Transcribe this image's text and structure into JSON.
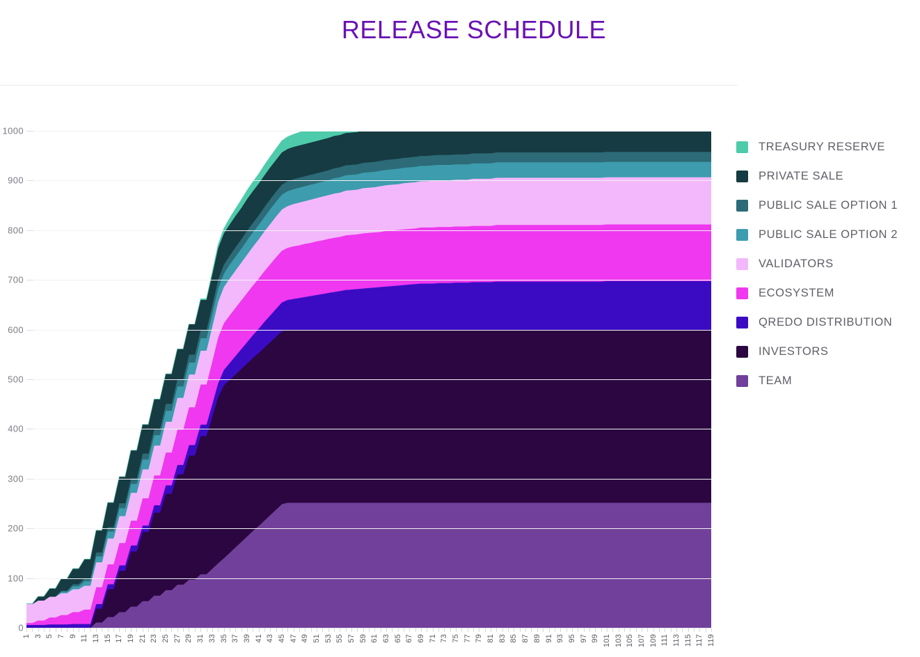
{
  "title": "RELEASE SCHEDULE",
  "title_color": "#6a11b5",
  "legend": {
    "position": "right",
    "items": [
      {
        "label": "TREASURY RESERVE",
        "color": "#4ecbab"
      },
      {
        "label": "PRIVATE SALE",
        "color": "#173b42"
      },
      {
        "label": "PUBLIC SALE OPTION 1",
        "color": "#2c6b77"
      },
      {
        "label": "PUBLIC SALE OPTION 2",
        "color": "#3d9cad"
      },
      {
        "label": "VALIDATORS",
        "color": "#f3b8fb"
      },
      {
        "label": "ECOSYSTEM",
        "color": "#ef38ef"
      },
      {
        "label": "QREDO DISTRIBUTION",
        "color": "#3b0bc4"
      },
      {
        "label": "INVESTORS",
        "color": "#2b0640"
      },
      {
        "label": "TEAM",
        "color": "#71409a"
      }
    ]
  },
  "chart_data": {
    "type": "area",
    "stacked": true,
    "title": "RELEASE SCHEDULE",
    "xlabel": "",
    "ylabel": "",
    "ylim": [
      0,
      1000
    ],
    "xlim": [
      1,
      119
    ],
    "grid": true,
    "legend_position": "right",
    "y_ticks": [
      0,
      100,
      200,
      300,
      400,
      500,
      600,
      700,
      800,
      900,
      1000
    ],
    "x_ticks": [
      1,
      3,
      5,
      7,
      9,
      11,
      13,
      15,
      17,
      19,
      21,
      23,
      25,
      27,
      29,
      31,
      33,
      35,
      37,
      39,
      41,
      43,
      45,
      47,
      49,
      51,
      53,
      55,
      57,
      59,
      61,
      63,
      65,
      67,
      69,
      71,
      73,
      75,
      77,
      79,
      81,
      83,
      85,
      87,
      89,
      91,
      93,
      95,
      97,
      99,
      101,
      103,
      105,
      107,
      109,
      111,
      113,
      115,
      117,
      119
    ],
    "x": [
      1,
      2,
      3,
      4,
      5,
      6,
      7,
      8,
      9,
      10,
      11,
      12,
      13,
      14,
      15,
      16,
      17,
      18,
      19,
      20,
      21,
      22,
      23,
      24,
      25,
      26,
      27,
      28,
      29,
      30,
      31,
      32,
      33,
      34,
      35,
      36,
      37,
      38,
      39,
      40,
      41,
      42,
      43,
      44,
      45,
      46,
      47,
      48,
      49,
      50,
      51,
      52,
      53,
      54,
      55,
      56,
      57,
      58,
      59,
      60,
      61,
      62,
      63,
      64,
      65,
      66,
      67,
      68,
      69,
      70,
      71,
      72,
      73,
      74,
      75,
      76,
      77,
      78,
      79,
      80,
      81,
      82,
      83,
      84,
      85,
      86,
      87,
      88,
      89,
      90,
      91,
      92,
      93,
      94,
      95,
      96,
      97,
      98,
      99,
      100,
      101,
      102,
      103,
      104,
      105,
      106,
      107,
      108,
      109,
      110,
      111,
      112,
      113,
      114,
      115,
      116,
      117,
      118,
      119
    ],
    "series": [
      {
        "name": "TEAM",
        "color": "#71409a",
        "values": [
          0,
          0,
          0,
          0,
          0,
          0,
          0,
          0,
          0,
          0,
          0,
          0,
          11,
          11,
          22,
          22,
          32,
          32,
          43,
          43,
          54,
          54,
          65,
          65,
          76,
          76,
          87,
          87,
          97,
          97,
          108,
          108,
          119,
          130,
          140,
          151,
          162,
          173,
          184,
          195,
          205,
          216,
          227,
          238,
          249,
          252,
          252,
          252,
          252,
          252,
          252,
          252,
          252,
          252,
          252,
          252,
          252,
          252,
          252,
          252,
          252,
          252,
          252,
          252,
          252,
          252,
          252,
          252,
          252,
          252,
          252,
          252,
          252,
          252,
          252,
          252,
          252,
          252,
          252,
          252,
          252,
          252,
          252,
          252,
          252,
          252,
          252,
          252,
          252,
          252,
          252,
          252,
          252,
          252,
          252,
          252,
          252,
          252,
          252,
          252,
          252,
          252,
          252,
          252,
          252,
          252,
          252,
          252,
          252,
          252,
          252,
          252,
          252,
          252,
          252,
          252,
          252,
          252,
          252
        ]
      },
      {
        "name": "INVESTORS",
        "color": "#2b0640",
        "values": [
          0,
          0,
          0,
          0,
          0,
          0,
          0,
          0,
          0,
          0,
          0,
          0,
          28,
          28,
          56,
          56,
          83,
          83,
          111,
          111,
          139,
          139,
          167,
          167,
          194,
          194,
          222,
          222,
          250,
          250,
          278,
          278,
          306,
          334,
          348,
          348,
          348,
          348,
          348,
          348,
          348,
          348,
          348,
          348,
          348,
          348,
          348,
          348,
          348,
          348,
          348,
          348,
          348,
          348,
          348,
          348,
          348,
          348,
          348,
          348,
          348,
          348,
          348,
          348,
          348,
          348,
          348,
          348,
          348,
          348,
          348,
          348,
          348,
          348,
          348,
          348,
          348,
          348,
          348,
          348,
          348,
          348,
          348,
          348,
          348,
          348,
          348,
          348,
          348,
          348,
          348,
          348,
          348,
          348,
          348,
          348,
          348,
          348,
          348,
          348,
          348,
          348,
          348,
          348,
          348,
          348,
          348,
          348,
          348,
          348,
          348,
          348,
          348,
          348,
          348,
          348,
          348,
          348,
          348
        ]
      },
      {
        "name": "QREDO DISTRIBUTION",
        "color": "#3b0bc4",
        "values": [
          6,
          6,
          6,
          6,
          7,
          7,
          7,
          7,
          8,
          8,
          8,
          8,
          9,
          9,
          10,
          10,
          11,
          11,
          12,
          12,
          13,
          13,
          15,
          15,
          17,
          17,
          19,
          19,
          21,
          21,
          23,
          23,
          25,
          28,
          31,
          34,
          37,
          40,
          43,
          46,
          49,
          52,
          54,
          56,
          58,
          60,
          62,
          64,
          66,
          68,
          70,
          72,
          74,
          76,
          78,
          80,
          81,
          82,
          83,
          84,
          85,
          86,
          87,
          88,
          89,
          90,
          91,
          92,
          93,
          93,
          93,
          94,
          94,
          94,
          95,
          95,
          95,
          96,
          96,
          96,
          96,
          97,
          97,
          97,
          97,
          97,
          97,
          97,
          97,
          97,
          97,
          97,
          97,
          97,
          97,
          97,
          97,
          97,
          97,
          97,
          98,
          98,
          98,
          98,
          98,
          98,
          98,
          98,
          98,
          98,
          98,
          98,
          98,
          98,
          98,
          98,
          98,
          98,
          98
        ]
      },
      {
        "name": "ECOSYSTEM",
        "color": "#ef38ef",
        "values": [
          4,
          4,
          9,
          9,
          14,
          14,
          19,
          19,
          24,
          24,
          29,
          29,
          34,
          34,
          40,
          40,
          45,
          45,
          50,
          50,
          55,
          55,
          60,
          60,
          66,
          66,
          71,
          71,
          76,
          76,
          81,
          81,
          86,
          92,
          94,
          96,
          97,
          98,
          99,
          100,
          101,
          102,
          103,
          104,
          104,
          105,
          106,
          106,
          107,
          107,
          108,
          108,
          109,
          109,
          109,
          110,
          110,
          110,
          111,
          111,
          111,
          111,
          112,
          112,
          112,
          112,
          112,
          112,
          113,
          113,
          113,
          113,
          113,
          113,
          113,
          113,
          113,
          113,
          113,
          113,
          113,
          114,
          114,
          114,
          114,
          114,
          114,
          114,
          114,
          114,
          114,
          114,
          114,
          114,
          114,
          114,
          114,
          114,
          114,
          114,
          114,
          114,
          114,
          114,
          114,
          114,
          114,
          114,
          114,
          114,
          114,
          114,
          114,
          114,
          114,
          114,
          114,
          114,
          114
        ]
      },
      {
        "name": "VALIDATORS",
        "color": "#f3b8fb",
        "values": [
          38,
          38,
          40,
          40,
          42,
          42,
          44,
          44,
          46,
          46,
          48,
          48,
          50,
          50,
          52,
          52,
          54,
          54,
          56,
          56,
          58,
          58,
          60,
          60,
          62,
          62,
          64,
          64,
          66,
          66,
          68,
          68,
          70,
          72,
          73,
          74,
          75,
          76,
          77,
          78,
          79,
          80,
          81,
          82,
          83,
          84,
          85,
          86,
          86,
          87,
          87,
          88,
          88,
          89,
          89,
          90,
          90,
          90,
          91,
          91,
          91,
          92,
          92,
          92,
          92,
          93,
          93,
          93,
          93,
          93,
          94,
          94,
          94,
          94,
          94,
          94,
          94,
          95,
          95,
          95,
          95,
          95,
          95,
          95,
          95,
          95,
          95,
          95,
          95,
          95,
          95,
          95,
          95,
          95,
          95,
          95,
          95,
          95,
          95,
          95,
          95,
          95,
          95,
          95,
          95,
          95,
          95,
          95,
          95,
          95,
          95,
          95,
          95,
          95,
          95,
          95,
          95,
          95,
          95
        ]
      },
      {
        "name": "PUBLIC SALE OPTION 2",
        "color": "#3d9cad",
        "values": [
          0,
          0,
          0,
          0,
          0,
          0,
          3,
          3,
          6,
          6,
          9,
          9,
          12,
          12,
          14,
          14,
          16,
          16,
          18,
          18,
          20,
          20,
          21,
          21,
          22,
          22,
          23,
          23,
          24,
          24,
          25,
          25,
          26,
          27,
          27,
          28,
          28,
          28,
          29,
          29,
          29,
          29,
          30,
          30,
          30,
          30,
          30,
          30,
          30,
          30,
          30,
          30,
          30,
          31,
          31,
          31,
          31,
          31,
          31,
          31,
          31,
          31,
          31,
          31,
          31,
          31,
          31,
          31,
          31,
          31,
          31,
          31,
          31,
          31,
          31,
          31,
          31,
          31,
          31,
          31,
          31,
          31,
          31,
          31,
          31,
          31,
          31,
          31,
          31,
          31,
          31,
          31,
          31,
          31,
          31,
          31,
          31,
          31,
          31,
          31,
          31,
          31,
          31,
          31,
          31,
          31,
          31,
          31,
          31,
          31,
          31,
          31,
          31,
          31,
          31,
          31,
          31,
          31,
          31
        ]
      },
      {
        "name": "PUBLIC SALE OPTION 1",
        "color": "#2c6b77",
        "values": [
          0,
          0,
          0,
          0,
          0,
          0,
          2,
          2,
          4,
          4,
          6,
          6,
          8,
          8,
          9,
          9,
          10,
          10,
          11,
          11,
          12,
          12,
          13,
          13,
          14,
          14,
          15,
          15,
          16,
          16,
          16,
          16,
          17,
          18,
          18,
          18,
          19,
          19,
          19,
          19,
          19,
          20,
          20,
          20,
          20,
          20,
          20,
          20,
          20,
          20,
          20,
          20,
          20,
          20,
          20,
          20,
          20,
          20,
          20,
          20,
          20,
          20,
          20,
          20,
          20,
          20,
          20,
          20,
          20,
          20,
          20,
          20,
          20,
          20,
          20,
          20,
          20,
          20,
          20,
          20,
          20,
          20,
          20,
          20,
          20,
          20,
          20,
          20,
          20,
          20,
          20,
          20,
          20,
          20,
          20,
          20,
          20,
          20,
          20,
          20,
          20,
          20,
          20,
          20,
          20,
          20,
          20,
          20,
          20,
          20,
          20,
          20,
          20,
          20,
          20,
          20,
          20,
          20,
          20
        ]
      },
      {
        "name": "PRIVATE SALE",
        "color": "#173b42",
        "values": [
          0,
          0,
          8,
          8,
          16,
          16,
          24,
          24,
          31,
          31,
          38,
          38,
          44,
          44,
          49,
          49,
          53,
          53,
          56,
          56,
          58,
          58,
          59,
          59,
          60,
          60,
          60,
          60,
          61,
          61,
          61,
          61,
          62,
          63,
          63,
          63,
          63,
          63,
          64,
          64,
          64,
          64,
          64,
          64,
          65,
          65,
          65,
          65,
          65,
          65,
          65,
          65,
          65,
          65,
          65,
          65,
          65,
          65,
          65,
          65,
          65,
          65,
          65,
          65,
          65,
          65,
          65,
          65,
          65,
          65,
          65,
          65,
          65,
          65,
          65,
          65,
          65,
          65,
          65,
          65,
          65,
          65,
          65,
          65,
          65,
          65,
          65,
          65,
          65,
          65,
          65,
          65,
          65,
          65,
          65,
          65,
          65,
          65,
          65,
          65,
          65,
          65,
          65,
          65,
          65,
          65,
          65,
          65,
          65,
          65,
          65,
          65,
          65,
          65,
          65,
          65,
          65,
          65,
          65
        ]
      },
      {
        "name": "TREASURY RESERVE",
        "color": "#4ecbab",
        "values": [
          0,
          0,
          0,
          0,
          0,
          0,
          0,
          0,
          0,
          0,
          0,
          0,
          0,
          0,
          0,
          0,
          0,
          0,
          0,
          0,
          0,
          0,
          0,
          0,
          0,
          0,
          0,
          0,
          0,
          0,
          2,
          2,
          4,
          6,
          9,
          12,
          14,
          16,
          17,
          18,
          19,
          20,
          21,
          22,
          23,
          24,
          25,
          26,
          27,
          28,
          29,
          30,
          31,
          32,
          33,
          34,
          35,
          36,
          37,
          38,
          39,
          40,
          40,
          41,
          42,
          43,
          43,
          44,
          45,
          45,
          46,
          46,
          47,
          47,
          48,
          48,
          49,
          49,
          50,
          50,
          50,
          51,
          51,
          51,
          52,
          52,
          52,
          53,
          53,
          53,
          54,
          54,
          54,
          54,
          54,
          55,
          55,
          55,
          55,
          55,
          55,
          55,
          55,
          55,
          55,
          55,
          55,
          55,
          55,
          55,
          55,
          55,
          55,
          55,
          55,
          55,
          55,
          55,
          55
        ]
      }
    ]
  }
}
